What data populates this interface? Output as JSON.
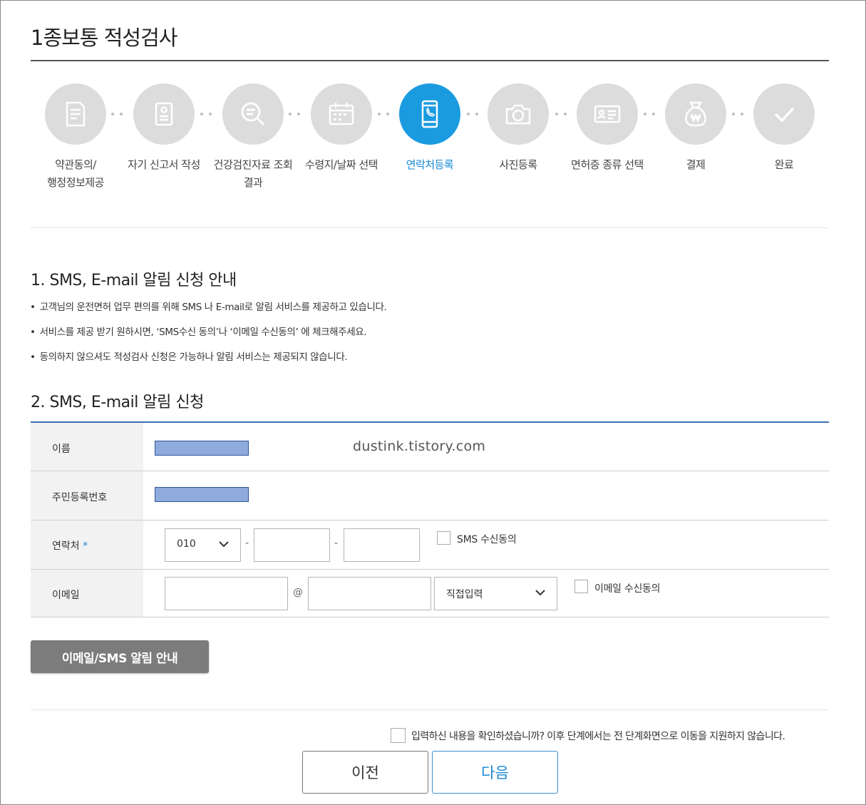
{
  "page": {
    "title": "1종보통 적성검사"
  },
  "colors": {
    "accent": "#1a9be0",
    "step_inactive": "#dcdcdc",
    "masked_fill": "#8faadc",
    "form_border": "#3a6fb5"
  },
  "steps": [
    {
      "icon": "document-icon",
      "line1": "약관동의/",
      "line2": "행정정보제공",
      "active": false
    },
    {
      "icon": "report-icon",
      "line1": "자기 신고서 작성",
      "line2": "",
      "active": false
    },
    {
      "icon": "magnifier-icon",
      "line1": "건강검진자료 조회",
      "line2": "결과",
      "active": false
    },
    {
      "icon": "calendar-icon",
      "line1": "수령지/날짜 선택",
      "line2": "",
      "active": false
    },
    {
      "icon": "phone-icon",
      "line1": "연락처등록",
      "line2": "",
      "active": true
    },
    {
      "icon": "camera-icon",
      "line1": "사진등록",
      "line2": "",
      "active": false
    },
    {
      "icon": "license-card-icon",
      "line1": "면허증 종류 선택",
      "line2": "",
      "active": false
    },
    {
      "icon": "won-bag-icon",
      "line1": "결제",
      "line2": "",
      "active": false
    },
    {
      "icon": "check-icon",
      "line1": "완료",
      "line2": "",
      "active": false
    }
  ],
  "section1": {
    "title": "1. SMS, E-mail 알림 신청 안내",
    "bullets": [
      "고객님의 운전면허 업무 편의를 위해 SMS 나 E-mail로 알림 서비스를 제공하고 있습니다.",
      "서비스를 제공 받기 원하시면, ‘SMS수신 동의’나 ‘이메일 수신동의’ 에 체크해주세요.",
      "동의하지 않으셔도 적성검사 신청은 가능하나 알림 서비스는 제공되지 않습니다."
    ]
  },
  "section2": {
    "title": "2. SMS, E-mail 알림 신청"
  },
  "form": {
    "name_label": "이름",
    "watermark": "dustink.tistory.com",
    "rrn_label": "주민등록번호",
    "phone_label": "연락처",
    "required_mark": "*",
    "phone_prefix": "010",
    "dash": "-",
    "sms_consent": "SMS 수신동의",
    "email_label": "이메일",
    "at": "@",
    "domain_select": "직접입력",
    "email_consent": "이메일 수신동의"
  },
  "notice_button": "이메일/SMS 알림 안내",
  "confirm_text": "입력하신 내용을 확인하셨습니까? 이후 단계에서는 전 단계화면으로 이동을 지원하지 않습니다.",
  "buttons": {
    "prev": "이전",
    "next": "다음"
  }
}
